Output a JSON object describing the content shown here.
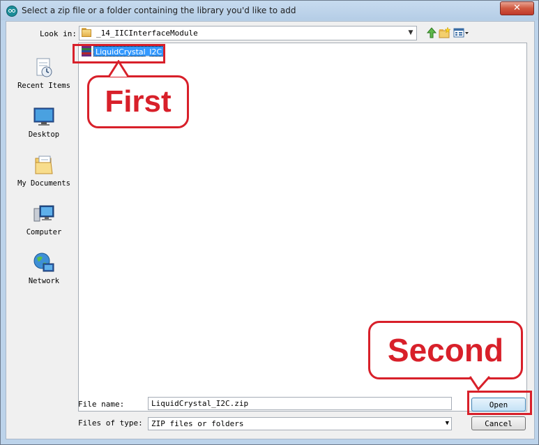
{
  "window": {
    "title": "Select a zip file or a folder containing the library you'd like to add",
    "close_label": "✕",
    "app_icon": "arduino-icon"
  },
  "toolbar": {
    "look_in_label": "Look in:",
    "look_in_value": "_14_IICInterfaceModule",
    "up_icon": "up-folder-icon",
    "new_folder_icon": "new-folder-icon",
    "view_menu_icon": "view-menu-icon"
  },
  "places": [
    {
      "label": "Recent Items",
      "icon": "recent-items-icon"
    },
    {
      "label": "Desktop",
      "icon": "desktop-icon"
    },
    {
      "label": "My Documents",
      "icon": "my-documents-icon"
    },
    {
      "label": "Computer",
      "icon": "computer-icon"
    },
    {
      "label": "Network",
      "icon": "network-icon"
    }
  ],
  "files": [
    {
      "name": "LiquidCrystal_I2C",
      "icon": "archive-icon",
      "selected": true
    }
  ],
  "annotations": {
    "first": "First",
    "second": "Second",
    "color": "#d8202a"
  },
  "fields": {
    "file_name_label": "File name:",
    "file_name_value": "LiquidCrystal_I2C.zip",
    "file_type_label": "Files of type:",
    "file_type_value": "ZIP files or folders"
  },
  "buttons": {
    "open": "Open",
    "cancel": "Cancel"
  },
  "colors": {
    "selection": "#3399ff",
    "titlebar": "#bcd3ea"
  }
}
